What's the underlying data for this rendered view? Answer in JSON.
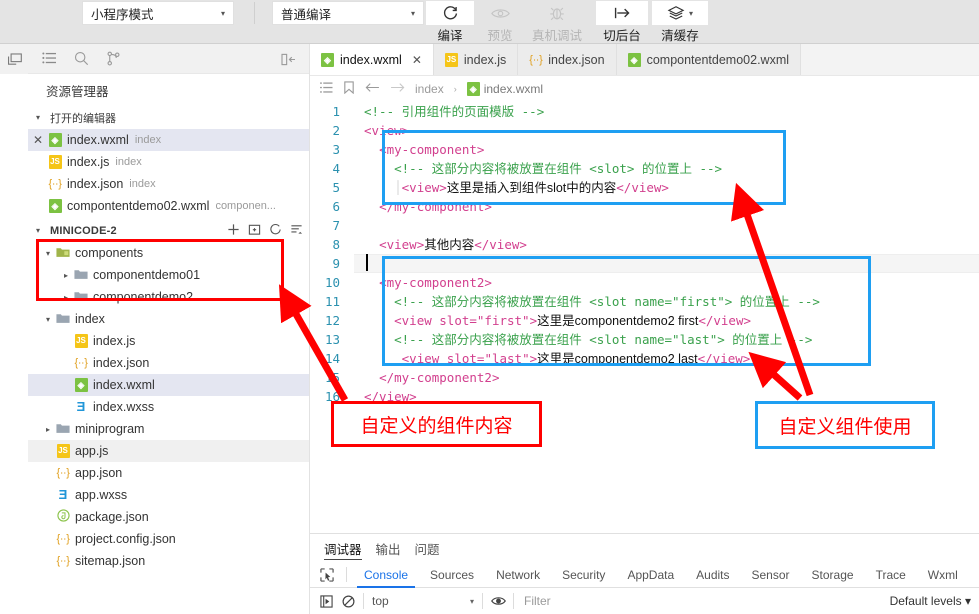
{
  "toolbar": {
    "mode_select": {
      "value": "小程序模式",
      "caret": "▾"
    },
    "compile_select": {
      "value": "普通编译",
      "caret": "▾"
    },
    "buttons": [
      {
        "icon": "refresh-icon",
        "label": "编译",
        "enabled": true
      },
      {
        "icon": "eye-icon",
        "label": "预览",
        "enabled": false
      },
      {
        "icon": "bug-icon",
        "label": "真机调试",
        "enabled": false
      },
      {
        "icon": "switch-background-icon",
        "label": "切后台",
        "enabled": true
      },
      {
        "icon": "layers-icon",
        "label": "清缓存",
        "enabled": true,
        "caret": "▾"
      }
    ]
  },
  "activitybar": {
    "top_icon": "split-editor-icon"
  },
  "sidebar": {
    "icon_row": [
      {
        "name": "explorer-icon"
      },
      {
        "name": "search-icon"
      },
      {
        "name": "source-control-icon"
      }
    ],
    "collapse_icon": "collapse-sidebar-icon",
    "title": "资源管理器",
    "open_editors": {
      "twisty": "▾",
      "label": "打开的编辑器",
      "items": [
        {
          "icon": "wxml-file-icon",
          "name": "index.wxml",
          "sub": "index",
          "selected": true,
          "closable": true
        },
        {
          "icon": "js-file-icon",
          "name": "index.js",
          "sub": "index",
          "selected": false
        },
        {
          "icon": "json-file-icon",
          "name": "index.json",
          "sub": "index",
          "selected": false
        },
        {
          "icon": "wxml-file-icon",
          "name": "compontentdemo02.wxml",
          "sub": "componen...",
          "selected": false
        }
      ]
    },
    "project": {
      "twisty": "▾",
      "label": "MINICODE-2",
      "actions": [
        "new-file-icon",
        "new-folder-icon",
        "refresh-icon",
        "collapse-all-icon"
      ],
      "tree": [
        {
          "kind": "folder",
          "twisty": "▾",
          "icon": "folder-components-icon",
          "name": "components",
          "depth": 0
        },
        {
          "kind": "folder",
          "twisty": "▸",
          "icon": "folder-icon",
          "name": "componentdemo01",
          "depth": 1
        },
        {
          "kind": "folder",
          "twisty": "▸",
          "icon": "folder-icon",
          "name": "componentdemo2",
          "depth": 1
        },
        {
          "kind": "folder",
          "twisty": "▾",
          "icon": "folder-icon",
          "name": "index",
          "depth": 0
        },
        {
          "kind": "file",
          "icon": "js-file-icon",
          "name": "index.js",
          "depth": 1
        },
        {
          "kind": "file",
          "icon": "json-file-icon",
          "name": "index.json",
          "depth": 1
        },
        {
          "kind": "file",
          "icon": "wxml-file-icon",
          "name": "index.wxml",
          "depth": 1,
          "selected": true
        },
        {
          "kind": "file",
          "icon": "wxss-file-icon",
          "name": "index.wxss",
          "depth": 1
        },
        {
          "kind": "folder",
          "twisty": "▸",
          "icon": "folder-icon",
          "name": "miniprogram",
          "depth": 0
        },
        {
          "kind": "file",
          "icon": "js-file-icon",
          "name": "app.js",
          "depth": 0,
          "hover": true
        },
        {
          "kind": "file",
          "icon": "json-file-icon",
          "name": "app.json",
          "depth": 0
        },
        {
          "kind": "file",
          "icon": "wxss-file-icon",
          "name": "app.wxss",
          "depth": 0
        },
        {
          "kind": "file",
          "icon": "package-json-icon",
          "name": "package.json",
          "depth": 0
        },
        {
          "kind": "file",
          "icon": "json-file-icon",
          "name": "project.config.json",
          "depth": 0
        },
        {
          "kind": "file",
          "icon": "json-file-icon",
          "name": "sitemap.json",
          "depth": 0
        }
      ]
    }
  },
  "editor": {
    "tabs": [
      {
        "icon": "wxml-file-icon",
        "label": "index.wxml",
        "active": true,
        "close": "✕"
      },
      {
        "icon": "js-file-icon",
        "label": "index.js",
        "active": false
      },
      {
        "icon": "json-file-icon",
        "label": "index.json",
        "active": false
      },
      {
        "icon": "wxml-file-icon",
        "label": "compontentdemo02.wxml",
        "active": false
      }
    ],
    "breadcrumb": {
      "icons": [
        "outline-icon",
        "bookmark-icon",
        "back-arrow-icon",
        "forward-arrow-icon"
      ],
      "path": [
        "index",
        "index.wxml"
      ],
      "separator": "›",
      "file_icon": "wxml-file-icon"
    },
    "code_lines": [
      {
        "n": "1",
        "tokens": [
          {
            "t": "com",
            "v": "<!-- 引用组件的页面模版 -->"
          }
        ]
      },
      {
        "n": "2",
        "tokens": [
          {
            "t": "tag",
            "v": "<view>"
          }
        ]
      },
      {
        "n": "3",
        "tokens": [
          {
            "t": "sp",
            "v": "  "
          },
          {
            "t": "tag",
            "v": "<my-component>"
          }
        ]
      },
      {
        "n": "4",
        "tokens": [
          {
            "t": "sp",
            "v": "  "
          },
          {
            "t": "gd",
            "v": "│"
          },
          {
            "t": "sp",
            "v": " "
          },
          {
            "t": "com",
            "v": "<!-- 这部分内容将被放置在组件 <slot> 的位置上 -->"
          }
        ]
      },
      {
        "n": "5",
        "tokens": [
          {
            "t": "sp",
            "v": "  "
          },
          {
            "t": "gd",
            "v": "│"
          },
          {
            "t": "sp",
            "v": " "
          },
          {
            "t": "gd",
            "v": "│"
          },
          {
            "t": "tag",
            "v": "<view>"
          },
          {
            "t": "txt",
            "v": "这里是插入到组件slot中的内容"
          },
          {
            "t": "tag",
            "v": "</view>"
          }
        ]
      },
      {
        "n": "6",
        "tokens": [
          {
            "t": "sp",
            "v": "  "
          },
          {
            "t": "tag",
            "v": "</my-component>"
          }
        ]
      },
      {
        "n": "7",
        "tokens": []
      },
      {
        "n": "8",
        "tokens": [
          {
            "t": "sp",
            "v": "  "
          },
          {
            "t": "tag",
            "v": "<view>"
          },
          {
            "t": "txt",
            "v": "其他内容"
          },
          {
            "t": "tag",
            "v": "</view>"
          }
        ]
      },
      {
        "n": "9",
        "tokens": []
      },
      {
        "n": "10",
        "tokens": [
          {
            "t": "sp",
            "v": "  "
          },
          {
            "t": "tag",
            "v": "<my-component2>"
          }
        ]
      },
      {
        "n": "11",
        "tokens": [
          {
            "t": "sp",
            "v": "  "
          },
          {
            "t": "gd",
            "v": "│"
          },
          {
            "t": "sp",
            "v": " "
          },
          {
            "t": "com",
            "v": "<!-- 这部分内容将被放置在组件 <slot name=\"first\"> 的位置上 -->"
          }
        ]
      },
      {
        "n": "12",
        "tokens": [
          {
            "t": "sp",
            "v": "  "
          },
          {
            "t": "gd",
            "v": "│"
          },
          {
            "t": "sp",
            "v": " "
          },
          {
            "t": "tag",
            "v": "<view slot=\"first\">"
          },
          {
            "t": "txt",
            "v": "这里是componentdemo2 first"
          },
          {
            "t": "tag",
            "v": "</view>"
          }
        ]
      },
      {
        "n": "13",
        "tokens": [
          {
            "t": "sp",
            "v": "  "
          },
          {
            "t": "gd",
            "v": "│"
          },
          {
            "t": "sp",
            "v": " "
          },
          {
            "t": "com",
            "v": "<!-- 这部分内容将被放置在组件 <slot name=\"last\"> 的位置上 -->"
          }
        ]
      },
      {
        "n": "14",
        "tokens": [
          {
            "t": "sp",
            "v": "  "
          },
          {
            "t": "gd",
            "v": "│"
          },
          {
            "t": "sp",
            "v": "  "
          },
          {
            "t": "tag",
            "v": "<view slot=\"last\">"
          },
          {
            "t": "txt",
            "v": "这里是componentdemo2 last"
          },
          {
            "t": "tag",
            "v": "</view>"
          }
        ]
      },
      {
        "n": "15",
        "tokens": [
          {
            "t": "sp",
            "v": "  "
          },
          {
            "t": "tag",
            "v": "</my-component2>"
          }
        ]
      },
      {
        "n": "16",
        "tokens": [
          {
            "t": "tag",
            "v": "</view>"
          }
        ]
      }
    ]
  },
  "annotations": {
    "note_left": {
      "text": "自定义的组件内容",
      "border_color": "#ff0000",
      "text_color": "#ff0000"
    },
    "note_right": {
      "text": "自定义组件使用",
      "border_color": "#1e9ff2",
      "text_color": "#ff0000"
    },
    "arrow_color": "#ff0000",
    "highlight_red": "#ff0000",
    "highlight_blue": "#1e9ff2"
  },
  "panel": {
    "tabs": [
      {
        "label": "调试器",
        "active": true
      },
      {
        "label": "输出",
        "active": false
      },
      {
        "label": "问题",
        "active": false
      }
    ],
    "devtools_tabs": [
      {
        "label": "Console",
        "active": true
      },
      {
        "label": "Sources",
        "active": false
      },
      {
        "label": "Network",
        "active": false
      },
      {
        "label": "Security",
        "active": false
      },
      {
        "label": "AppData",
        "active": false
      },
      {
        "label": "Audits",
        "active": false
      },
      {
        "label": "Sensor",
        "active": false
      },
      {
        "label": "Storage",
        "active": false
      },
      {
        "label": "Trace",
        "active": false
      },
      {
        "label": "Wxml",
        "active": false
      }
    ],
    "inspect_icon": "inspect-element-icon",
    "console_bar": {
      "execute_icon": "execute-icon",
      "clear_icon": "clear-console-icon",
      "context": "top",
      "context_caret": "▾",
      "eye_icon": "live-expression-icon",
      "filter_placeholder": "Filter",
      "levels": "Default levels",
      "levels_caret": "▾"
    }
  }
}
